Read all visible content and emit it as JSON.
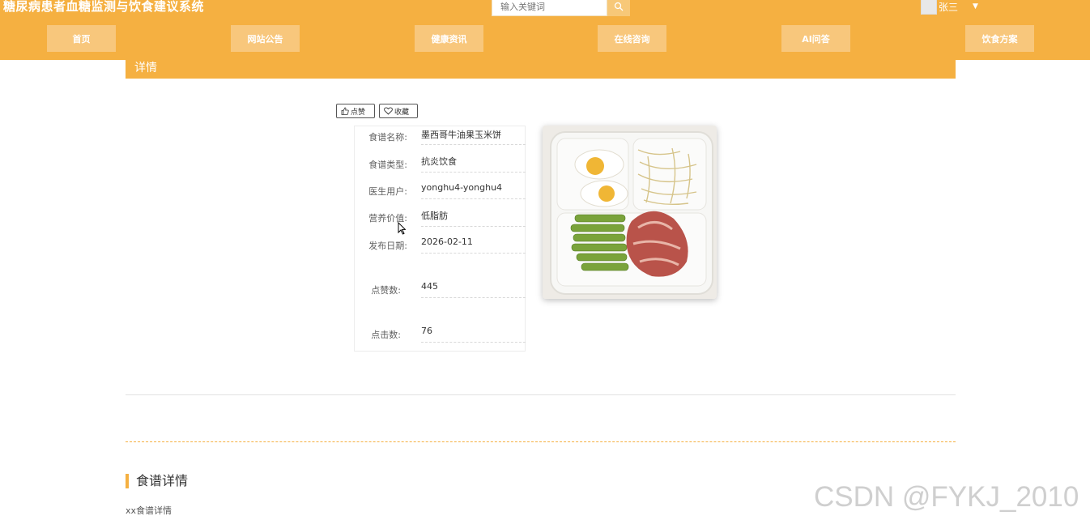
{
  "header": {
    "site_title": "糖尿病患者血糖监测与饮食建议系统",
    "search_placeholder": "输入关键词",
    "user_name": "张三",
    "nav": [
      {
        "label": "首页"
      },
      {
        "label": "网站公告"
      },
      {
        "label": "健康资讯"
      },
      {
        "label": "在线咨询"
      },
      {
        "label": "AI问答"
      },
      {
        "label": "饮食方案"
      }
    ]
  },
  "detail": {
    "title": "详情",
    "like_label": "点赞",
    "favorite_label": "收藏",
    "rows": [
      {
        "label": "食谱名称:",
        "value": "墨西哥牛油果玉米饼"
      },
      {
        "label": "食谱类型:",
        "value": "抗炎饮食"
      },
      {
        "label": "医生用户:",
        "value": "yonghu4-yonghu4"
      },
      {
        "label": "营养价值:",
        "value": "低脂肪"
      },
      {
        "label": "发布日期:",
        "value": "2026-02-11"
      },
      {
        "label": "点赞数:",
        "value": "445"
      },
      {
        "label": "点击数:",
        "value": "76"
      }
    ]
  },
  "recipe_section": {
    "title": "食谱详情",
    "text": "xx食谱详情"
  },
  "watermark": "CSDN @FYKJ_2010",
  "colors": {
    "primary": "#f5b041",
    "nav_button": "#f8c77c"
  }
}
